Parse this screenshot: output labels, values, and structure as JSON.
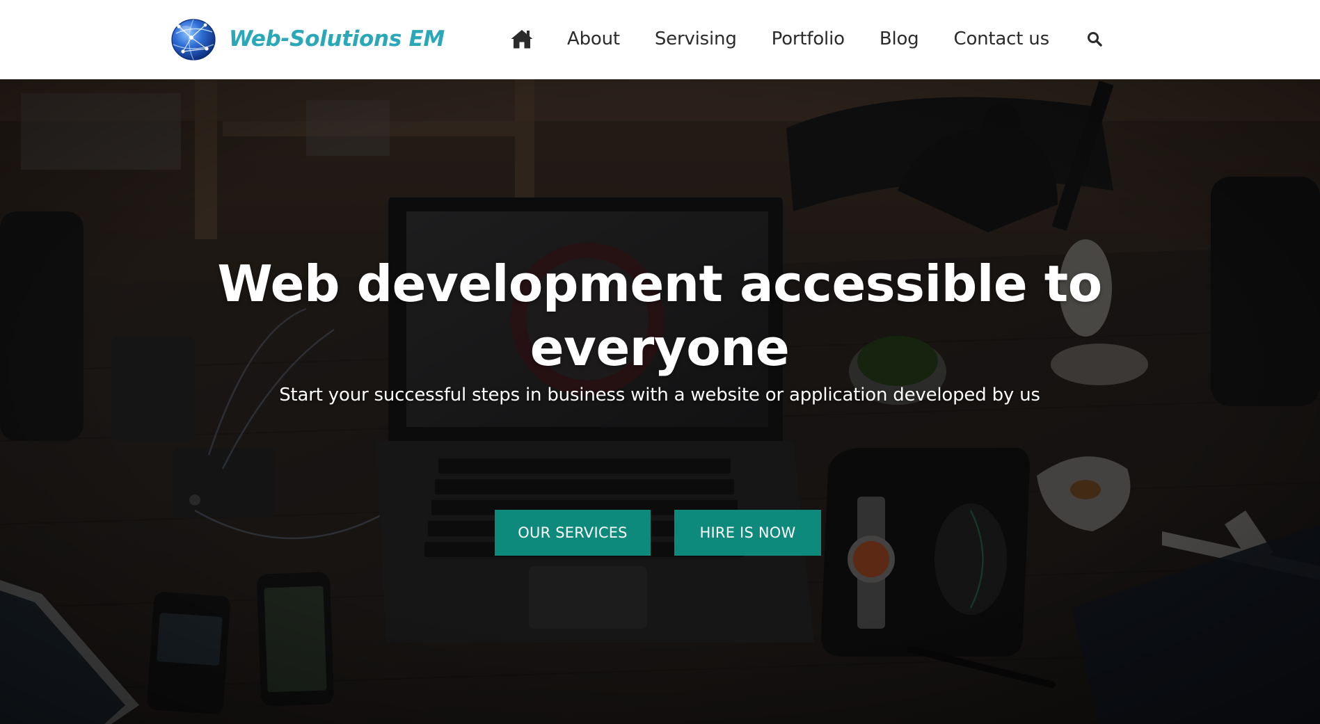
{
  "header": {
    "brand_name": "Web-Solutions EM",
    "brand_icon": "globe-network-icon",
    "nav": {
      "home_icon": "home-icon",
      "items": [
        {
          "label": "About"
        },
        {
          "label": "Servising"
        },
        {
          "label": "Portfolio"
        },
        {
          "label": "Blog"
        },
        {
          "label": "Contact us"
        }
      ],
      "search_icon": "search-icon"
    }
  },
  "hero": {
    "title": "Web development accessible to everyone",
    "subtitle": "Start your successful steps in business with a website or application developed by us",
    "buttons": {
      "services_label": "OUR SERVICES",
      "hire_label": "HIRE IS NOW"
    },
    "background_image": "dark-desk-workspace-photo"
  },
  "colors": {
    "brand_text": "#2aa8b8",
    "nav_text": "#2b2b2b",
    "accent_button": "#0e8a7c",
    "hero_text": "#ffffff",
    "header_bg": "#ffffff"
  }
}
